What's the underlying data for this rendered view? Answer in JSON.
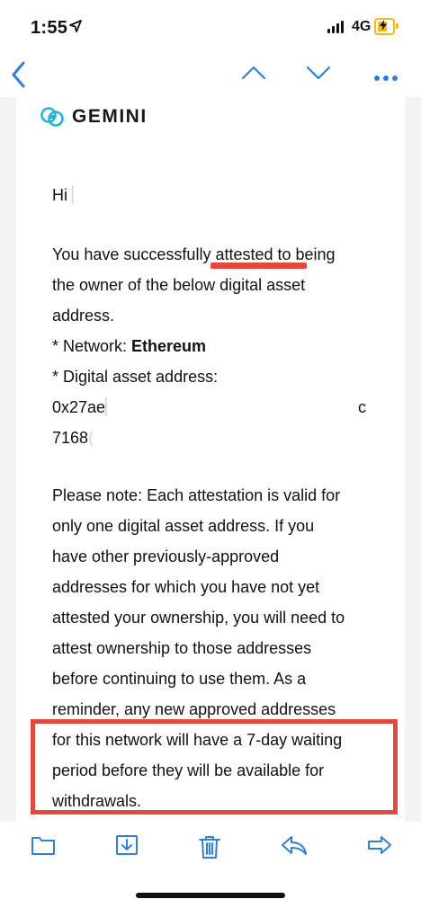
{
  "status": {
    "time": "1:55",
    "network": "4G"
  },
  "nav": {
    "back_icon": "chevron-left-icon",
    "prev_icon": "chevron-up-icon",
    "next_icon": "chevron-down-icon",
    "more_icon": "ellipsis-icon"
  },
  "email": {
    "brand": "GEMINI",
    "greeting": "Hi",
    "para1_line1": "You have successfully attested to being",
    "para1_line2": "the owner of the below digital asset",
    "para1_line3": "address.",
    "network_label": "* Network: ",
    "network_value": "Ethereum",
    "address_label": "* Digital asset address:",
    "address_line1_start": "0x27ae",
    "address_line1_end": "c",
    "address_line2_start": "7168",
    "note_line1": "Please note: Each attestation is valid for",
    "note_line2": "only one digital asset address. If you",
    "note_line3": "have other previously-approved",
    "note_line4": "addresses for which you have not yet",
    "note_line5": "attested your ownership, you will need to",
    "note_line6": "attest ownership to those addresses",
    "note_line7": "before continuing to use them. As a",
    "note_line8": "reminder, any new approved addresses",
    "note_line9": "for this network will have a 7-day waiting",
    "note_line10": "period before they will be available for",
    "note_line11": "withdrawals."
  },
  "toolbar": {
    "folder_icon": "folder-icon",
    "archive_icon": "archive-icon",
    "trash_icon": "trash-icon",
    "reply_icon": "reply-icon",
    "forward_icon": "forward-icon"
  },
  "colors": {
    "ios_blue": "#2f7fdc",
    "annotation_red": "#e2483e",
    "battery_yellow": "#f4b71c",
    "gemini_teal": "#25b3d6"
  }
}
